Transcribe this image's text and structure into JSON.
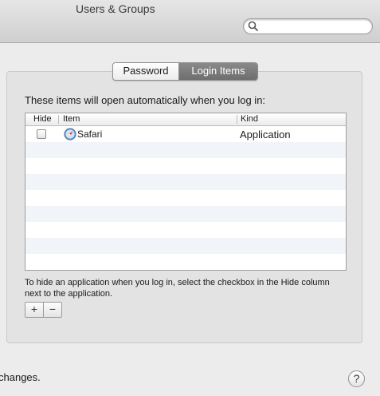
{
  "window": {
    "title": "Users & Groups"
  },
  "search": {
    "value": "",
    "placeholder": ""
  },
  "tabs": [
    {
      "label": "Password",
      "active": false
    },
    {
      "label": "Login Items",
      "active": true
    }
  ],
  "login_items": {
    "intro": "These items will open automatically when you log in:",
    "columns": {
      "hide": "Hide",
      "item": "Item",
      "kind": "Kind"
    },
    "rows": [
      {
        "hide": false,
        "icon": "safari-icon",
        "item": "Safari",
        "kind": "Application"
      }
    ],
    "hint": "To hide an application when you log in, select the checkbox in the Hide column next to the application.",
    "add_label": "+",
    "remove_label": "−"
  },
  "footer": {
    "text": "changes.",
    "help_label": "?"
  },
  "colors": {
    "selected_tab": "#7d7d7d",
    "alt_row": "#f1f4f8"
  }
}
